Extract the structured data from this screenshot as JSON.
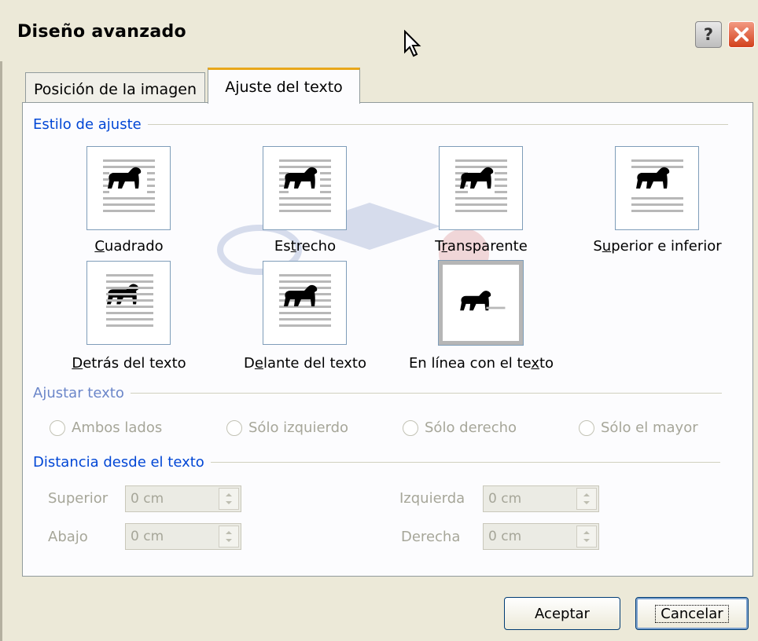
{
  "window": {
    "title": "Diseño avanzado"
  },
  "titlebar": {
    "help_label": "?",
    "help_icon": "question-icon",
    "close_icon": "close-x-icon"
  },
  "tabs": [
    {
      "label": "Posición de la imagen",
      "active": false
    },
    {
      "label": "Ajuste del texto",
      "active": true
    }
  ],
  "wrap_style": {
    "heading": "Estilo de ajuste",
    "options": [
      {
        "pre": "",
        "u": "C",
        "post": "uadrado",
        "icon": "square-wrap-icon",
        "selected": false
      },
      {
        "pre": "Es",
        "u": "t",
        "post": "recho",
        "icon": "tight-wrap-icon",
        "selected": false
      },
      {
        "pre": "T",
        "u": "r",
        "post": "ansparente",
        "icon": "through-wrap-icon",
        "selected": false
      },
      {
        "pre": "S",
        "u": "u",
        "post": "perior e inferior",
        "icon": "top-bottom-wrap-icon",
        "selected": false
      },
      {
        "pre": "",
        "u": "D",
        "post": "etrás del texto",
        "icon": "behind-text-icon",
        "selected": false
      },
      {
        "pre": "D",
        "u": "e",
        "post": "lante del texto",
        "icon": "in-front-of-text-icon",
        "selected": false
      },
      {
        "pre": "En línea con el te",
        "u": "x",
        "post": "to",
        "icon": "inline-with-text-icon",
        "selected": true
      }
    ]
  },
  "wrap_text": {
    "heading": "Ajustar texto",
    "options": [
      "Ambos lados",
      "Sólo izquierdo",
      "Sólo derecho",
      "Sólo el mayor"
    ]
  },
  "distance": {
    "heading": "Distancia desde el texto",
    "fields": [
      {
        "label": "Superior",
        "value": "0 cm"
      },
      {
        "label": "Izquierda",
        "value": "0 cm"
      },
      {
        "label": "Abajo",
        "value": "0 cm"
      },
      {
        "label": "Derecha",
        "value": "0 cm"
      }
    ]
  },
  "buttons": {
    "ok": "Aceptar",
    "cancel": "Cancelar"
  },
  "colors": {
    "section_heading": "#0046d5",
    "tab_highlight": "#e8a71b",
    "dialog_bg": "#ece9d8"
  }
}
